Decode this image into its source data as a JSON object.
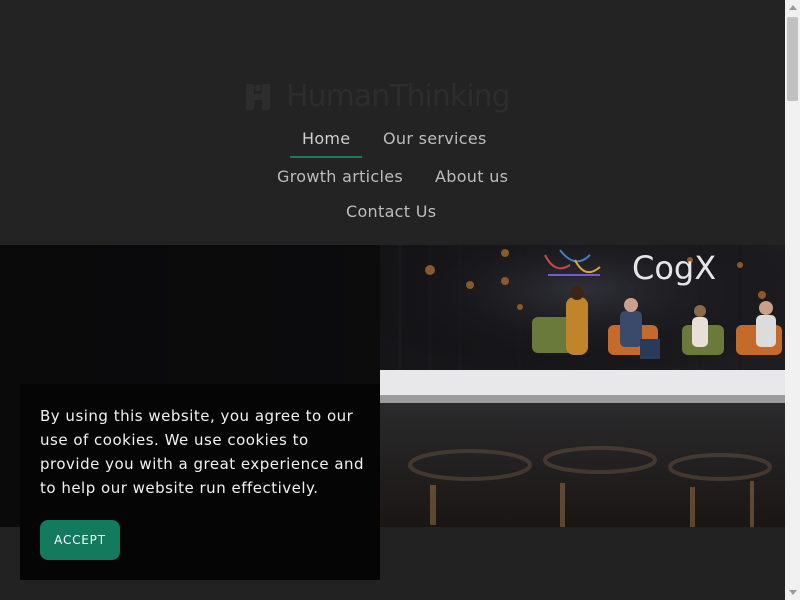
{
  "brand": {
    "name": "HumanThinking"
  },
  "nav": {
    "items": [
      {
        "label": "Home",
        "active": true
      },
      {
        "label": "Our services",
        "active": false
      },
      {
        "label": "Growth articles",
        "active": false
      },
      {
        "label": "About us",
        "active": false
      },
      {
        "label": "Contact Us",
        "active": false
      }
    ]
  },
  "hero": {
    "stage_sign": "CogX"
  },
  "cookie_banner": {
    "message": "By using this website, you agree to our use of cookies. We use cookies to provide you with a great experience and to help our website run effectively.",
    "accept_label": "ACCEPT"
  },
  "colors": {
    "accent": "#137a5e",
    "background": "#232223",
    "nav_text": "#bdbdbd"
  }
}
